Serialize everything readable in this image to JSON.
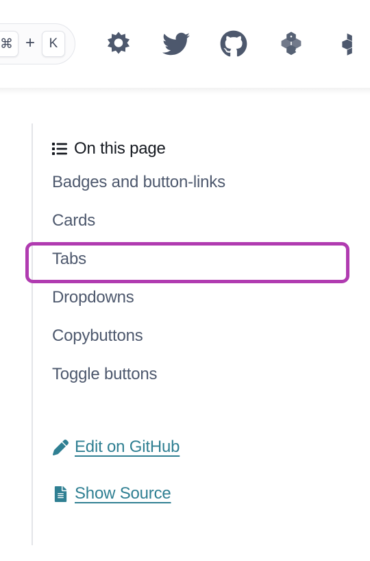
{
  "header": {
    "search": {
      "name": "search-shortcut-pill",
      "keys": [
        "⌘",
        "K"
      ],
      "separator": "+"
    },
    "icons": [
      {
        "name": "theme-switcher-sun-icon",
        "label": "Toggle light / dark / auto mode"
      },
      {
        "name": "twitter-icon",
        "label": "Twitter"
      },
      {
        "name": "github-icon",
        "label": "GitHub"
      },
      {
        "name": "pypi-icon",
        "label": "PyPI"
      },
      {
        "name": "conda-forge-icon",
        "label": "Conda Forge"
      }
    ]
  },
  "toc": {
    "caption": "On this page",
    "caption_icon": "list-icon",
    "items": [
      {
        "label": "Badges and button-links",
        "active": false
      },
      {
        "label": "Cards",
        "active": false
      },
      {
        "label": "Tabs",
        "active": true
      },
      {
        "label": "Dropdowns",
        "active": false
      },
      {
        "label": "Copybuttons",
        "active": false
      },
      {
        "label": "Toggle buttons",
        "active": false
      }
    ],
    "links": [
      {
        "label": "Edit on GitHub",
        "icon": "pencil-icon"
      },
      {
        "label": "Show Source",
        "icon": "file-document-icon"
      }
    ]
  },
  "colors": {
    "highlight": "#b03bb0",
    "link": "#2f7f92",
    "text": "#4d586d",
    "heading": "#14181f",
    "rule": "#e3e4e8"
  }
}
